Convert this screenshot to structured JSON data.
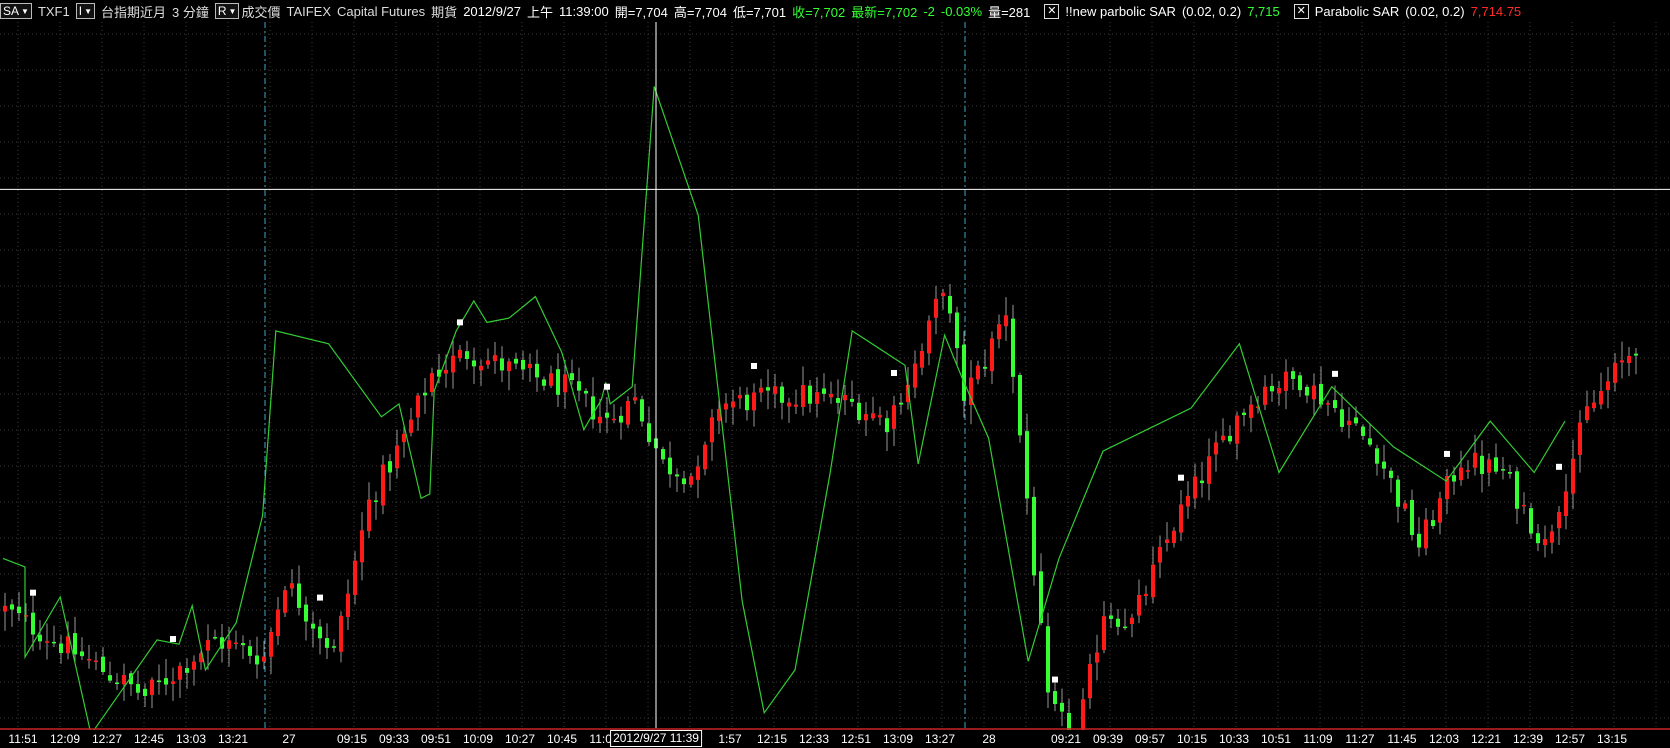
{
  "header": {
    "ticker_dropdown": "SA",
    "symbol": "TXF1",
    "interval_dropdown": "I",
    "contract_name": "台指期近月",
    "period": "3 分鐘",
    "price_type_dropdown": "R",
    "price_type": "成交價",
    "exchange": "TAIFEX",
    "broker": "Capital Futures",
    "market": "期貨",
    "date": "2012/9/27",
    "session": "上午",
    "time": "11:39:00",
    "open": "開=7,704",
    "high": "高=7,704",
    "low": "低=7,701",
    "close": "收=7,702",
    "last": "最新=7,702",
    "change": "-2",
    "change_pct": "-0.03%",
    "volume": "量=281",
    "indicator1_name": "!!new parbolic SAR",
    "indicator1_params": "(0.02,  0.2)",
    "indicator1_value": "7,715",
    "indicator2_name": "Parabolic SAR",
    "indicator2_params": "(0.02,  0.2)",
    "indicator2_value": "7,714.75"
  },
  "colors": {
    "up": "#ff1a1a",
    "down": "#33ff33",
    "sar_line": "#33cc33",
    "sar_dot": "#ffffff",
    "grid": "#3a3a3a",
    "session_divider": "#3fa8c8",
    "crosshair": "#ffffff",
    "axis_line": "#cc2222"
  },
  "time_axis": {
    "cursor_label": "2012/9/27 11:39",
    "labels": [
      {
        "text": "11:51",
        "i": 0
      },
      {
        "text": "12:09",
        "i": 6
      },
      {
        "text": "12:27",
        "i": 12
      },
      {
        "text": "12:45",
        "i": 18
      },
      {
        "text": "13:03",
        "i": 24
      },
      {
        "text": "13:21",
        "i": 30
      },
      {
        "text": "27",
        "i": 38
      },
      {
        "text": "09:15",
        "i": 47
      },
      {
        "text": "09:33",
        "i": 53
      },
      {
        "text": "09:51",
        "i": 59
      },
      {
        "text": "10:09",
        "i": 65
      },
      {
        "text": "10:27",
        "i": 71
      },
      {
        "text": "10:45",
        "i": 77
      },
      {
        "text": "11:03",
        "i": 83
      },
      {
        "text": "1:57",
        "i": 101
      },
      {
        "text": "12:15",
        "i": 107
      },
      {
        "text": "12:33",
        "i": 113
      },
      {
        "text": "12:51",
        "i": 119
      },
      {
        "text": "13:09",
        "i": 125
      },
      {
        "text": "13:27",
        "i": 131
      },
      {
        "text": "28",
        "i": 138
      },
      {
        "text": "09:21",
        "i": 149
      },
      {
        "text": "09:39",
        "i": 155
      },
      {
        "text": "09:57",
        "i": 161
      },
      {
        "text": "10:15",
        "i": 167
      },
      {
        "text": "10:33",
        "i": 173
      },
      {
        "text": "10:51",
        "i": 179
      },
      {
        "text": "11:09",
        "i": 185
      },
      {
        "text": "11:27",
        "i": 191
      },
      {
        "text": "11:45",
        "i": 197
      },
      {
        "text": "12:03",
        "i": 203
      },
      {
        "text": "12:21",
        "i": 209
      },
      {
        "text": "12:39",
        "i": 215
      },
      {
        "text": "12:57",
        "i": 221
      },
      {
        "text": "13:15",
        "i": 227
      }
    ]
  },
  "chart_data": {
    "type": "candlestick",
    "x_axis": "time (3-minute bars)",
    "bar_count": 234,
    "ylim": [
      7640,
      7805
    ],
    "session_breaks": [
      37,
      137
    ],
    "crosshair": {
      "index": 93,
      "price": 7766
    },
    "keypoints": [
      [
        0,
        7668
      ],
      [
        10,
        7658
      ],
      [
        20,
        7648
      ],
      [
        30,
        7661
      ],
      [
        37,
        7657
      ],
      [
        40,
        7675
      ],
      [
        47,
        7658
      ],
      [
        52,
        7693
      ],
      [
        57,
        7708
      ],
      [
        61,
        7723
      ],
      [
        66,
        7728
      ],
      [
        74,
        7723
      ],
      [
        80,
        7720
      ],
      [
        86,
        7712
      ],
      [
        90,
        7717
      ],
      [
        94,
        7702
      ],
      [
        99,
        7699
      ],
      [
        102,
        7716
      ],
      [
        108,
        7717
      ],
      [
        114,
        7718
      ],
      [
        121,
        7716
      ],
      [
        126,
        7712
      ],
      [
        131,
        7728
      ],
      [
        134,
        7744
      ],
      [
        137,
        7718
      ],
      [
        140,
        7726
      ],
      [
        143,
        7738
      ],
      [
        146,
        7694
      ],
      [
        149,
        7646
      ],
      [
        153,
        7637
      ],
      [
        157,
        7668
      ],
      [
        161,
        7665
      ],
      [
        167,
        7688
      ],
      [
        172,
        7702
      ],
      [
        176,
        7713
      ],
      [
        180,
        7720
      ],
      [
        185,
        7722
      ],
      [
        190,
        7715
      ],
      [
        196,
        7705
      ],
      [
        202,
        7683
      ],
      [
        208,
        7703
      ],
      [
        214,
        7700
      ],
      [
        220,
        7683
      ],
      [
        226,
        7714
      ],
      [
        233,
        7730
      ]
    ],
    "sar": [
      [
        0,
        7680
      ],
      [
        5,
        7678
      ],
      [
        5,
        7657
      ],
      [
        13,
        7671
      ],
      [
        20,
        7639
      ],
      [
        35,
        7661
      ],
      [
        40,
        7660
      ],
      [
        43,
        7669
      ],
      [
        46,
        7654
      ],
      [
        53,
        7665
      ],
      [
        59,
        7690
      ],
      [
        62,
        7733
      ],
      [
        74,
        7730
      ],
      [
        86,
        7713
      ],
      [
        90,
        7716
      ],
      [
        95,
        7694
      ],
      [
        97,
        7695
      ],
      [
        98,
        7719
      ],
      [
        103,
        7733
      ],
      [
        107,
        7740
      ],
      [
        110,
        7735
      ],
      [
        115,
        7736
      ],
      [
        121,
        7741
      ],
      [
        127,
        7728
      ],
      [
        132,
        7710
      ],
      [
        136,
        7717
      ],
      [
        137,
        7721
      ],
      [
        138,
        7716
      ],
      [
        143,
        7720
      ],
      [
        148,
        7790
      ],
      [
        158,
        7760
      ],
      [
        168,
        7670
      ],
      [
        173,
        7644
      ],
      [
        180,
        7654
      ],
      [
        188,
        7700
      ],
      [
        193,
        7733
      ],
      [
        205,
        7725
      ],
      [
        208,
        7702
      ],
      [
        214,
        7732
      ],
      [
        218,
        7722
      ],
      [
        224,
        7708
      ],
      [
        233,
        7656
      ],
      [
        240,
        7680
      ],
      [
        250,
        7705
      ],
      [
        260,
        7710
      ],
      [
        270,
        7715
      ],
      [
        281,
        7730
      ],
      [
        290,
        7700
      ],
      [
        302,
        7720
      ],
      [
        316,
        7706
      ],
      [
        328,
        7698
      ],
      [
        338,
        7712
      ],
      [
        348,
        7700
      ],
      [
        355,
        7712
      ]
    ],
    "sar_markers": [
      4,
      24,
      45,
      65,
      86,
      107,
      127,
      150,
      168,
      190,
      206,
      222
    ]
  }
}
